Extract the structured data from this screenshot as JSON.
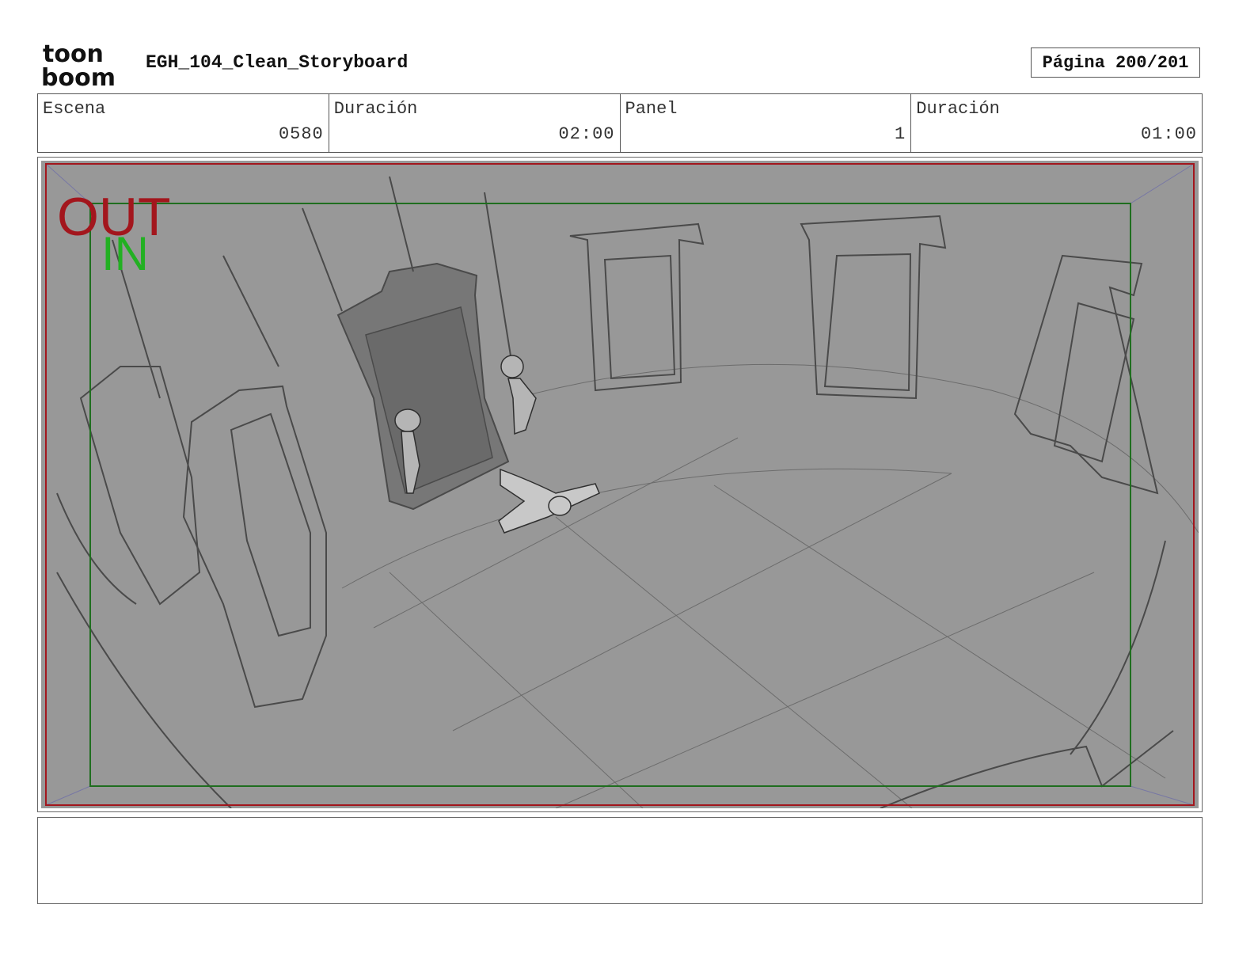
{
  "header": {
    "logo_text_top": "toon",
    "logo_text_bottom": "boom",
    "document_title": "EGH_104_Clean_Storyboard",
    "page_label": "Página",
    "page_value": "200/201"
  },
  "info": [
    {
      "label": "Escena",
      "value": "0580"
    },
    {
      "label": "Duración",
      "value": "02:00"
    },
    {
      "label": "Panel",
      "value": "1"
    },
    {
      "label": "Duración",
      "value": "01:00"
    }
  ],
  "panel": {
    "out_label": "OUT",
    "in_label": "IN",
    "colors": {
      "background": "#989898",
      "out_frame": "#a3161d",
      "in_frame": "#1f6e1f",
      "out_text": "#a3161d",
      "in_text": "#22b022",
      "sketch": "#4a4a4a"
    }
  },
  "notes": {
    "text": ""
  }
}
